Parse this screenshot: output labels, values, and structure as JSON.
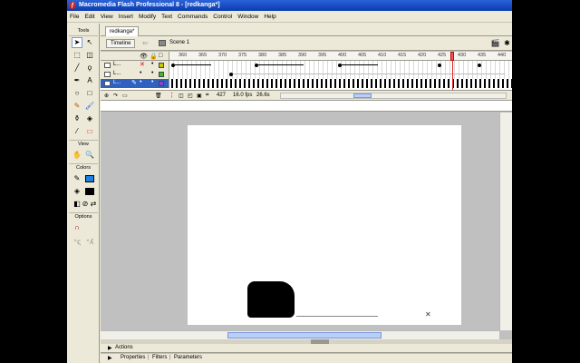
{
  "window": {
    "title": "Macromedia Flash Professional 8 - [redkanga*]"
  },
  "menu": [
    "File",
    "Edit",
    "View",
    "Insert",
    "Modify",
    "Text",
    "Commands",
    "Control",
    "Window",
    "Help"
  ],
  "tools": {
    "label": "Tools",
    "view_label": "View",
    "colors_label": "Colors",
    "options_label": "Options"
  },
  "doc": {
    "tab": "redkanga*"
  },
  "editbar": {
    "timeline_label": "Timeline",
    "scene_label": "Scene 1"
  },
  "timeline": {
    "ruler": [
      "360",
      "365",
      "370",
      "375",
      "380",
      "385",
      "390",
      "395",
      "400",
      "405",
      "410",
      "415",
      "420",
      "425",
      "430",
      "435",
      "440"
    ],
    "layers": [
      {
        "name": "L...",
        "swatch": "#c8c800"
      },
      {
        "name": "L...",
        "swatch": "#30c030"
      },
      {
        "name": "L...",
        "swatch": "#8844cc"
      }
    ],
    "frame": "427",
    "fps": "16.0 fps",
    "time": "26.6s"
  },
  "panels": {
    "actions": "Actions",
    "properties": "Properties",
    "filters": "Filters",
    "parameters": "Parameters"
  },
  "colors": {
    "accent": "#2a62d8",
    "chrome": "#ece9d8",
    "playhead": "#e02020"
  }
}
